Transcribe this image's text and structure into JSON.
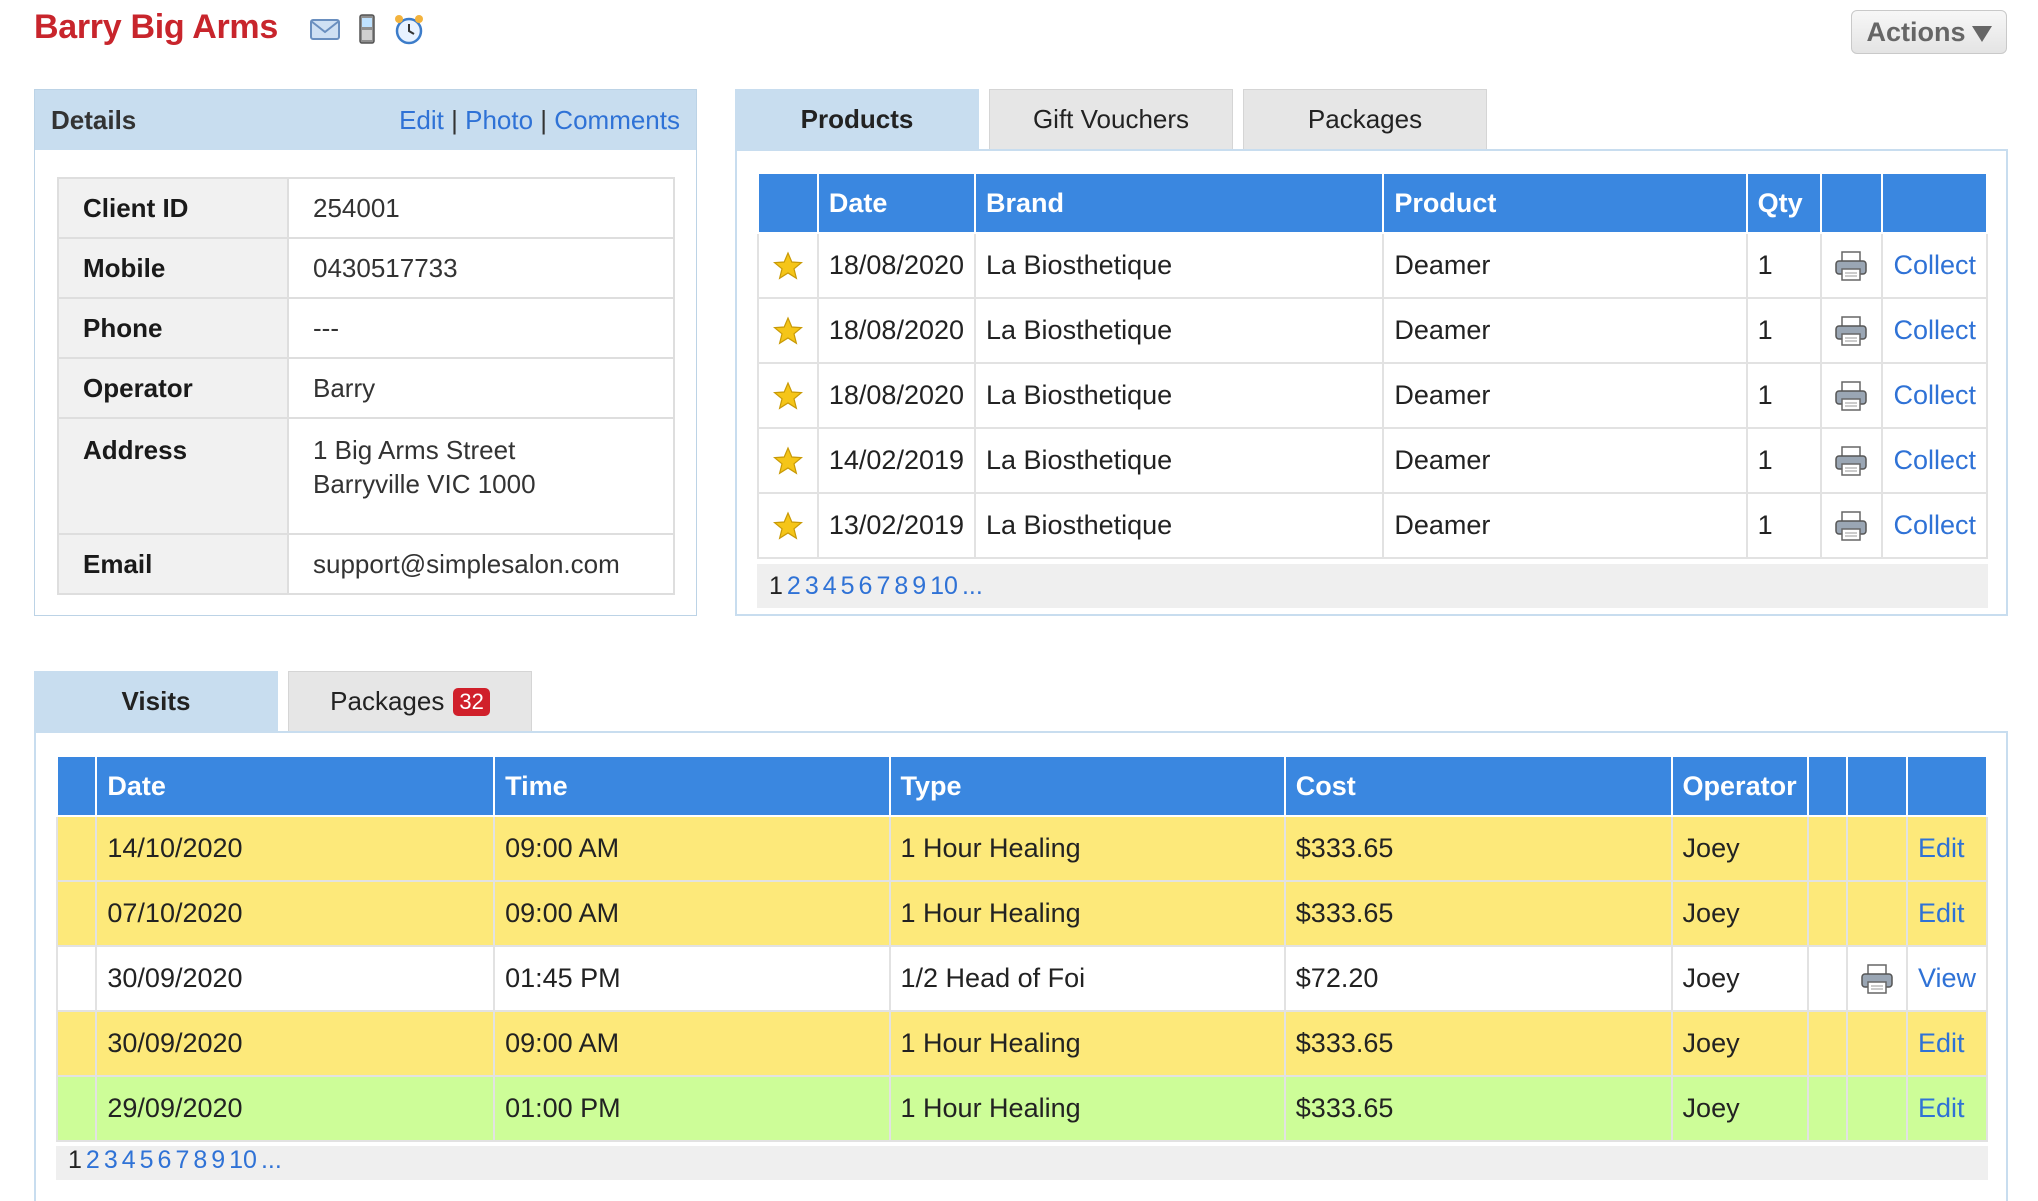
{
  "header": {
    "client_name": "Barry Big Arms",
    "actions_label": "Actions"
  },
  "details": {
    "title": "Details",
    "links": {
      "edit": "Edit",
      "photo": "Photo",
      "comments": "Comments",
      "separator": "|"
    },
    "rows": [
      {
        "label": "Client ID",
        "value": "254001"
      },
      {
        "label": "Mobile",
        "value": "0430517733"
      },
      {
        "label": "Phone",
        "value": "---"
      },
      {
        "label": "Operator",
        "value": "Barry"
      },
      {
        "label": "Address",
        "line1": "1 Big Arms Street",
        "line2": "Barryville VIC 1000"
      },
      {
        "label": "Email",
        "value": "support@simplesalon.com"
      }
    ]
  },
  "products_panel": {
    "tabs": [
      "Products",
      "Gift Vouchers",
      "Packages"
    ],
    "active_tab": "Products",
    "columns": [
      "",
      "Date",
      "Brand",
      "Product",
      "Qty",
      "",
      ""
    ],
    "rows": [
      {
        "date": "18/08/2020",
        "brand": "La Biosthetique",
        "product": "Deamer",
        "qty": "1",
        "action": "Collect"
      },
      {
        "date": "18/08/2020",
        "brand": "La Biosthetique",
        "product": "Deamer",
        "qty": "1",
        "action": "Collect"
      },
      {
        "date": "18/08/2020",
        "brand": "La Biosthetique",
        "product": "Deamer",
        "qty": "1",
        "action": "Collect"
      },
      {
        "date": "14/02/2019",
        "brand": "La Biosthetique",
        "product": "Deamer",
        "qty": "1",
        "action": "Collect"
      },
      {
        "date": "13/02/2019",
        "brand": "La Biosthetique",
        "product": "Deamer",
        "qty": "1",
        "action": "Collect"
      }
    ],
    "pager": {
      "current": "1",
      "pages": [
        "2",
        "3",
        "4",
        "5",
        "6",
        "7",
        "8",
        "9",
        "10"
      ],
      "more": "..."
    }
  },
  "visits_panel": {
    "tabs": [
      {
        "label": "Visits"
      },
      {
        "label": "Packages",
        "badge": "32"
      }
    ],
    "active_tab": "Visits",
    "columns": [
      "",
      "Date",
      "Time",
      "Type",
      "Cost",
      "Operator",
      "",
      "",
      ""
    ],
    "rows": [
      {
        "date": "14/10/2020",
        "time": "09:00 AM",
        "type": "1 Hour Healing",
        "cost": "$333.65",
        "operator": "Joey",
        "action": "Edit",
        "color": "yellow",
        "printer": false
      },
      {
        "date": "07/10/2020",
        "time": "09:00 AM",
        "type": "1 Hour Healing",
        "cost": "$333.65",
        "operator": "Joey",
        "action": "Edit",
        "color": "yellow",
        "printer": false
      },
      {
        "date": "30/09/2020",
        "time": "01:45 PM",
        "type": "1/2 Head of Foi",
        "cost": "$72.20",
        "operator": "Joey",
        "action": "View",
        "color": "white",
        "printer": true
      },
      {
        "date": "30/09/2020",
        "time": "09:00 AM",
        "type": "1 Hour Healing",
        "cost": "$333.65",
        "operator": "Joey",
        "action": "Edit",
        "color": "yellow",
        "printer": false
      },
      {
        "date": "29/09/2020",
        "time": "01:00 PM",
        "type": "1 Hour Healing",
        "cost": "$333.65",
        "operator": "Joey",
        "action": "Edit",
        "color": "green",
        "printer": false
      }
    ],
    "pager": {
      "current": "1",
      "pages": [
        "2",
        "3",
        "4",
        "5",
        "6",
        "7",
        "8",
        "9",
        "10"
      ],
      "more": "..."
    }
  },
  "colors": {
    "client_name": "#c8252c",
    "table_header": "#3a87e0",
    "tab_active": "#c8ddef",
    "row_yellow": "#fde97a",
    "row_green": "#cdfd98",
    "link": "#2f72d6",
    "badge": "#d0202b"
  },
  "icons": {
    "header": [
      "email-icon",
      "mobile-phone-icon",
      "alarm-clock-icon"
    ],
    "row_marker": "star-icon",
    "print": "printer-icon",
    "actions_caret": "caret-down-icon"
  }
}
